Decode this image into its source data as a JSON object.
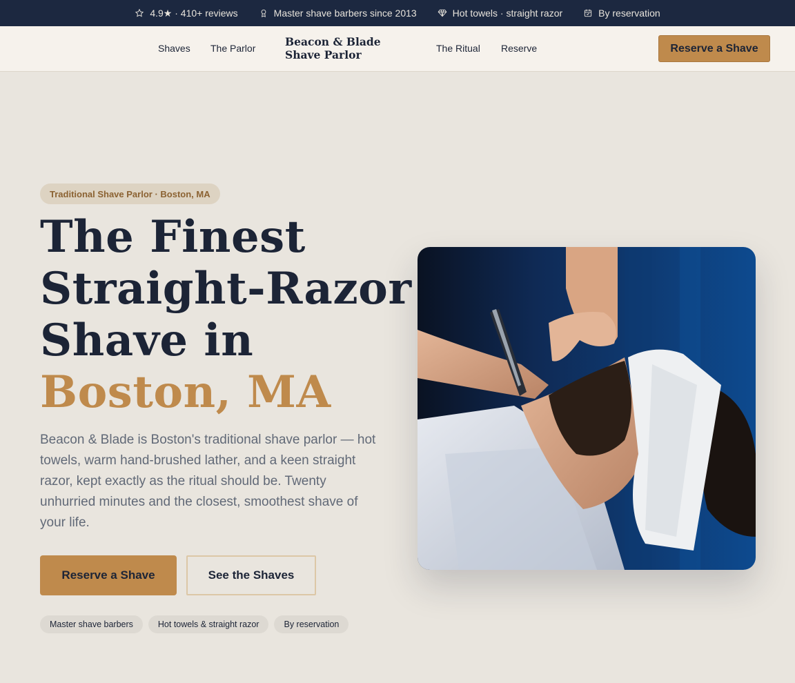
{
  "topbar": {
    "items": [
      {
        "icon": "star-icon",
        "label": "4.9★ · 410+ reviews"
      },
      {
        "icon": "award-icon",
        "label": "Master shave barbers since 2013"
      },
      {
        "icon": "diamond-icon",
        "label": "Hot towels · straight razor"
      },
      {
        "icon": "calendar-icon",
        "label": "By reservation"
      }
    ]
  },
  "nav": {
    "links": [
      "Shaves",
      "The Parlor",
      "The Ritual",
      "Reserve"
    ],
    "brand": "Beacon & Blade Shave Parlor",
    "cta": "Reserve a Shave"
  },
  "hero": {
    "eyebrow": "Traditional Shave Parlor · Boston, MA",
    "headline_main": "The Finest Straight-Razor Shave in",
    "headline_accent": "Boston, MA",
    "lead": "Beacon & Blade is Boston's traditional shave parlor — hot towels, warm hand-brushed lather, and a keen straight razor, kept exactly as the ritual should be. Twenty unhurried minutes and the closest, smoothest shave of your life.",
    "primary_cta": "Reserve a Shave",
    "secondary_cta": "See the Shaves",
    "chips": [
      "Master shave barbers",
      "Hot towels & straight razor",
      "By reservation"
    ]
  },
  "colors": {
    "navy": "#1c2840",
    "accent": "#bf8a4c",
    "background": "#e9e5de"
  }
}
